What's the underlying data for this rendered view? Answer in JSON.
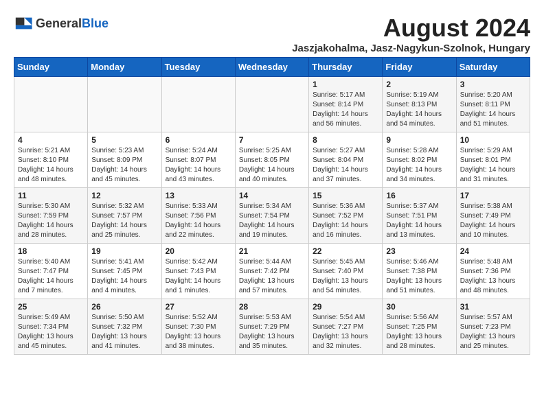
{
  "header": {
    "logo_general": "General",
    "logo_blue": "Blue",
    "month_year": "August 2024",
    "location": "Jaszjakohalma, Jasz-Nagykun-Szolnok, Hungary"
  },
  "days_of_week": [
    "Sunday",
    "Monday",
    "Tuesday",
    "Wednesday",
    "Thursday",
    "Friday",
    "Saturday"
  ],
  "weeks": [
    {
      "days": [
        {
          "num": "",
          "info": ""
        },
        {
          "num": "",
          "info": ""
        },
        {
          "num": "",
          "info": ""
        },
        {
          "num": "",
          "info": ""
        },
        {
          "num": "1",
          "info": "Sunrise: 5:17 AM\nSunset: 8:14 PM\nDaylight: 14 hours\nand 56 minutes."
        },
        {
          "num": "2",
          "info": "Sunrise: 5:19 AM\nSunset: 8:13 PM\nDaylight: 14 hours\nand 54 minutes."
        },
        {
          "num": "3",
          "info": "Sunrise: 5:20 AM\nSunset: 8:11 PM\nDaylight: 14 hours\nand 51 minutes."
        }
      ]
    },
    {
      "days": [
        {
          "num": "4",
          "info": "Sunrise: 5:21 AM\nSunset: 8:10 PM\nDaylight: 14 hours\nand 48 minutes."
        },
        {
          "num": "5",
          "info": "Sunrise: 5:23 AM\nSunset: 8:09 PM\nDaylight: 14 hours\nand 45 minutes."
        },
        {
          "num": "6",
          "info": "Sunrise: 5:24 AM\nSunset: 8:07 PM\nDaylight: 14 hours\nand 43 minutes."
        },
        {
          "num": "7",
          "info": "Sunrise: 5:25 AM\nSunset: 8:05 PM\nDaylight: 14 hours\nand 40 minutes."
        },
        {
          "num": "8",
          "info": "Sunrise: 5:27 AM\nSunset: 8:04 PM\nDaylight: 14 hours\nand 37 minutes."
        },
        {
          "num": "9",
          "info": "Sunrise: 5:28 AM\nSunset: 8:02 PM\nDaylight: 14 hours\nand 34 minutes."
        },
        {
          "num": "10",
          "info": "Sunrise: 5:29 AM\nSunset: 8:01 PM\nDaylight: 14 hours\nand 31 minutes."
        }
      ]
    },
    {
      "days": [
        {
          "num": "11",
          "info": "Sunrise: 5:30 AM\nSunset: 7:59 PM\nDaylight: 14 hours\nand 28 minutes."
        },
        {
          "num": "12",
          "info": "Sunrise: 5:32 AM\nSunset: 7:57 PM\nDaylight: 14 hours\nand 25 minutes."
        },
        {
          "num": "13",
          "info": "Sunrise: 5:33 AM\nSunset: 7:56 PM\nDaylight: 14 hours\nand 22 minutes."
        },
        {
          "num": "14",
          "info": "Sunrise: 5:34 AM\nSunset: 7:54 PM\nDaylight: 14 hours\nand 19 minutes."
        },
        {
          "num": "15",
          "info": "Sunrise: 5:36 AM\nSunset: 7:52 PM\nDaylight: 14 hours\nand 16 minutes."
        },
        {
          "num": "16",
          "info": "Sunrise: 5:37 AM\nSunset: 7:51 PM\nDaylight: 14 hours\nand 13 minutes."
        },
        {
          "num": "17",
          "info": "Sunrise: 5:38 AM\nSunset: 7:49 PM\nDaylight: 14 hours\nand 10 minutes."
        }
      ]
    },
    {
      "days": [
        {
          "num": "18",
          "info": "Sunrise: 5:40 AM\nSunset: 7:47 PM\nDaylight: 14 hours\nand 7 minutes."
        },
        {
          "num": "19",
          "info": "Sunrise: 5:41 AM\nSunset: 7:45 PM\nDaylight: 14 hours\nand 4 minutes."
        },
        {
          "num": "20",
          "info": "Sunrise: 5:42 AM\nSunset: 7:43 PM\nDaylight: 14 hours\nand 1 minutes."
        },
        {
          "num": "21",
          "info": "Sunrise: 5:44 AM\nSunset: 7:42 PM\nDaylight: 13 hours\nand 57 minutes."
        },
        {
          "num": "22",
          "info": "Sunrise: 5:45 AM\nSunset: 7:40 PM\nDaylight: 13 hours\nand 54 minutes."
        },
        {
          "num": "23",
          "info": "Sunrise: 5:46 AM\nSunset: 7:38 PM\nDaylight: 13 hours\nand 51 minutes."
        },
        {
          "num": "24",
          "info": "Sunrise: 5:48 AM\nSunset: 7:36 PM\nDaylight: 13 hours\nand 48 minutes."
        }
      ]
    },
    {
      "days": [
        {
          "num": "25",
          "info": "Sunrise: 5:49 AM\nSunset: 7:34 PM\nDaylight: 13 hours\nand 45 minutes."
        },
        {
          "num": "26",
          "info": "Sunrise: 5:50 AM\nSunset: 7:32 PM\nDaylight: 13 hours\nand 41 minutes."
        },
        {
          "num": "27",
          "info": "Sunrise: 5:52 AM\nSunset: 7:30 PM\nDaylight: 13 hours\nand 38 minutes."
        },
        {
          "num": "28",
          "info": "Sunrise: 5:53 AM\nSunset: 7:29 PM\nDaylight: 13 hours\nand 35 minutes."
        },
        {
          "num": "29",
          "info": "Sunrise: 5:54 AM\nSunset: 7:27 PM\nDaylight: 13 hours\nand 32 minutes."
        },
        {
          "num": "30",
          "info": "Sunrise: 5:56 AM\nSunset: 7:25 PM\nDaylight: 13 hours\nand 28 minutes."
        },
        {
          "num": "31",
          "info": "Sunrise: 5:57 AM\nSunset: 7:23 PM\nDaylight: 13 hours\nand 25 minutes."
        }
      ]
    }
  ]
}
